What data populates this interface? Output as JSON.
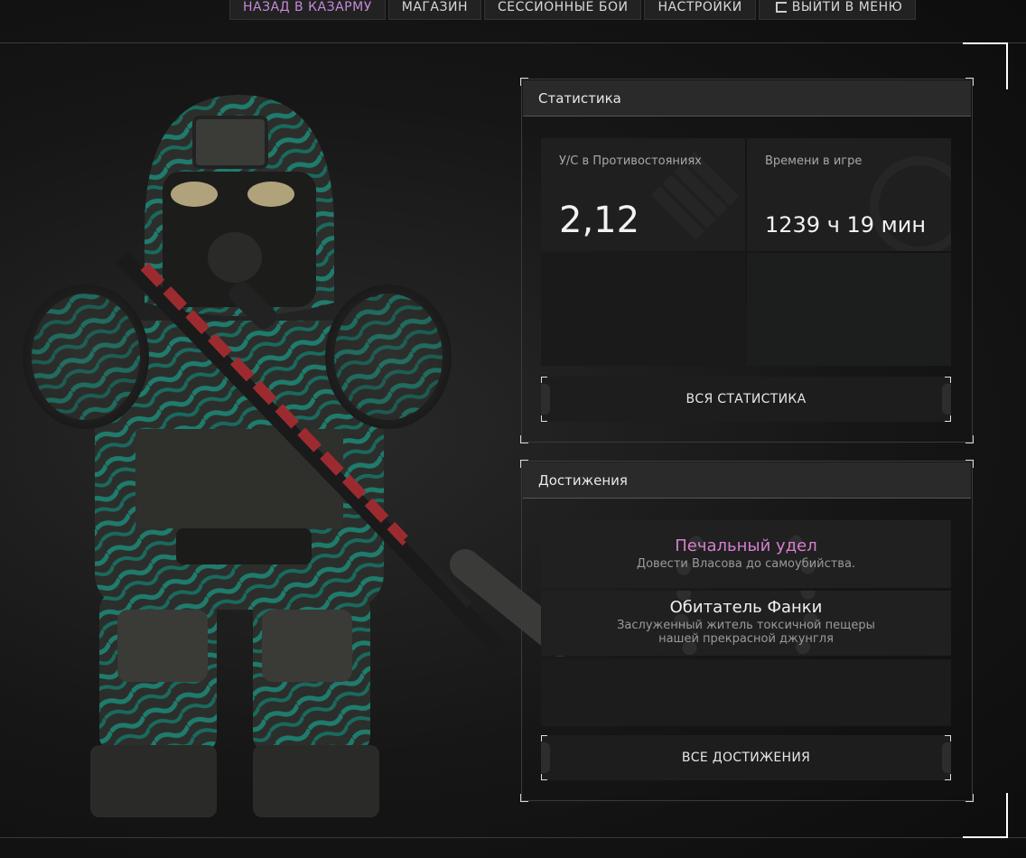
{
  "nav": {
    "tabs": [
      {
        "label": "НАЗАД В КАЗАРМУ",
        "active": true
      },
      {
        "label": "МАГАЗИН"
      },
      {
        "label": "СЕССИОННЫЕ БОИ"
      },
      {
        "label": "НАСТРОЙКИ"
      },
      {
        "label": "ВЫЙТИ В МЕНЮ",
        "icon": "exit-icon"
      }
    ]
  },
  "stats": {
    "title": "Статистика",
    "cards": [
      {
        "label": "У/С в Противостояниях",
        "value": "2,12",
        "icon": "diamond-icon"
      },
      {
        "label": "Времени в игре",
        "value": "1239 ч 19 мин",
        "icon": "clock-icon"
      }
    ],
    "all_button": "ВСЯ СТАТИСТИКА"
  },
  "achievements": {
    "title": "Достижения",
    "items": [
      {
        "title": "Печальный удел",
        "desc": "Довести Власова до самоубийства.",
        "color": "#d67fcf"
      },
      {
        "title": "Обитатель Фанки",
        "desc": "Заслуженный житель токсичной пещеры нашей прекрасной джунгля",
        "color": "#f0f0f0"
      }
    ],
    "all_button": "ВСЕ ДОСТИЖЕНИЯ"
  },
  "colors": {
    "accent": "#c58ad9",
    "panel": "#1f1f1f",
    "header": "#2a2a2a",
    "armor": "#3b3b38",
    "camo": "#1e7a6c",
    "rifle_red": "#9c2b30"
  }
}
